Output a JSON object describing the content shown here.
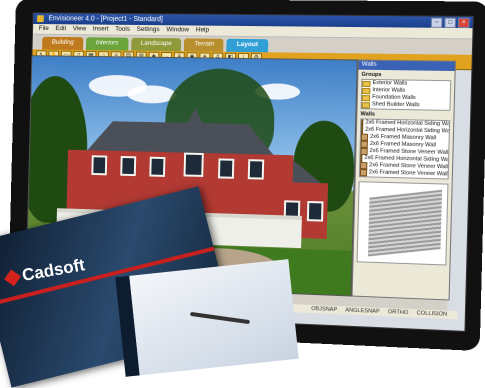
{
  "window": {
    "title": "Envisioneer 4.0 - [Project1 - Standard]"
  },
  "menu": [
    "File",
    "Edit",
    "View",
    "Insert",
    "Tools",
    "Settings",
    "Window",
    "Help"
  ],
  "tabs": [
    "Building",
    "Interiors",
    "Landscape",
    "Terrain",
    "Layout"
  ],
  "active_tab": "Layout",
  "panel": {
    "title": "Walls",
    "groups_label": "Groups",
    "groups": [
      "Exterior Walls",
      "Interior Walls",
      "Foundation Walls",
      "Shed Builder Walls"
    ],
    "walls_label": "Walls",
    "walls": [
      "2x6 Framed Horizontal Siding Wa",
      "2x6 Framed Horizontal Siding Wa",
      "2x6 Framed Masonry Wall",
      "2x6 Framed Masonry Wall",
      "2x6 Framed Stone Veneer Wall",
      "2x6 Framed Horizontal Siding Wa",
      "2x6 Framed Stone Veneer Wall",
      "2x6 Framed Stone Veneer Wall"
    ]
  },
  "status": [
    "OBJSNAP",
    "ANGLESNAP",
    "ORTHO",
    "COLLISION"
  ],
  "brand": {
    "name": "Cadsoft",
    "color": "#d4231c"
  }
}
